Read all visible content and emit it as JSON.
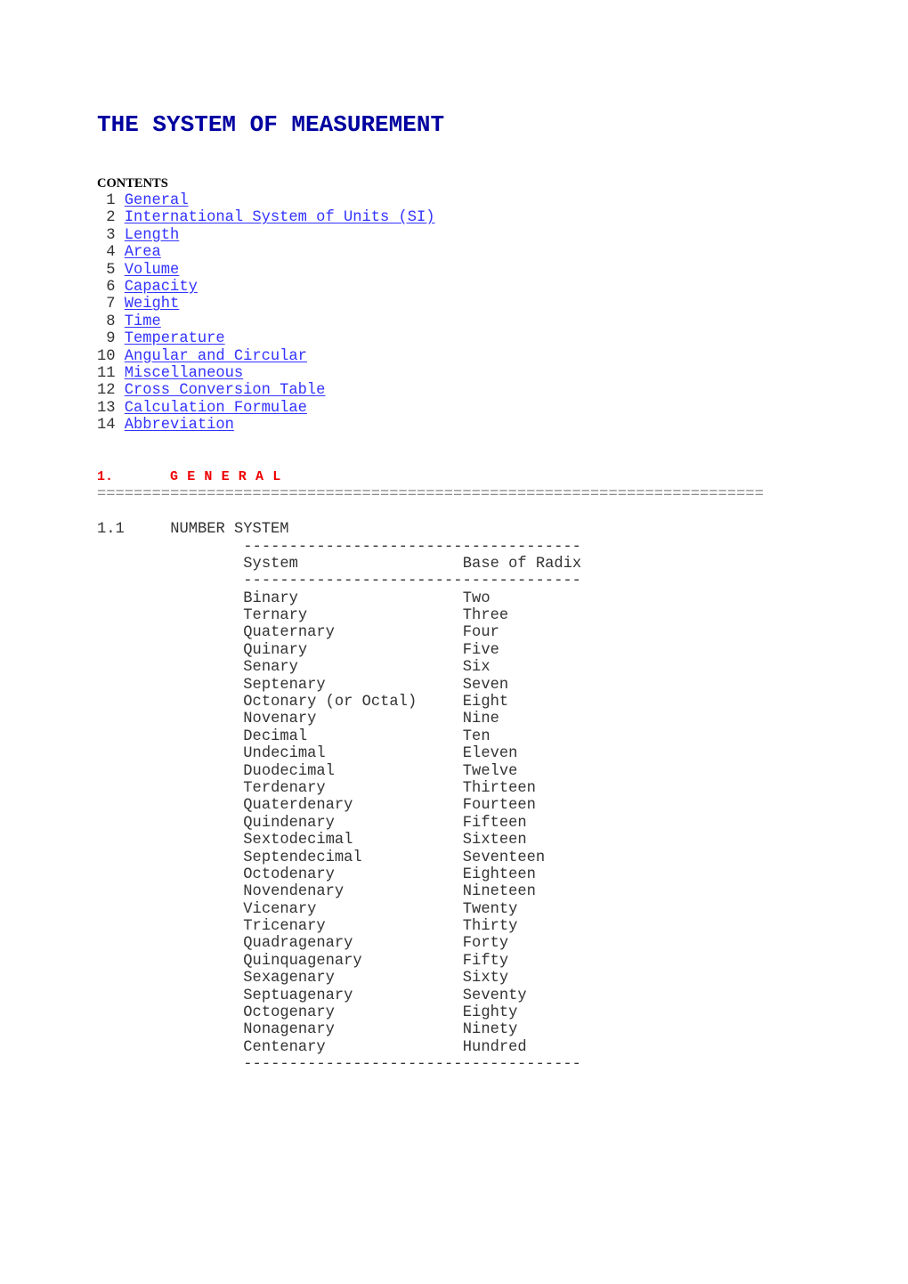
{
  "document": {
    "title": "THE SYSTEM OF MEASUREMENT",
    "contents": {
      "heading": "CONTENTS",
      "items": [
        {
          "num": "1",
          "label": "General"
        },
        {
          "num": "2",
          "label": "International System of Units (SI)"
        },
        {
          "num": "3",
          "label": "Length"
        },
        {
          "num": "4",
          "label": "Area"
        },
        {
          "num": "5",
          "label": "Volume"
        },
        {
          "num": "6",
          "label": "Capacity"
        },
        {
          "num": "7",
          "label": "Weight"
        },
        {
          "num": "8",
          "label": "Time"
        },
        {
          "num": "9",
          "label": "Temperature"
        },
        {
          "num": "10",
          "label": "Angular and Circular"
        },
        {
          "num": "11",
          "label": "Miscellaneous"
        },
        {
          "num": "12",
          "label": "Cross Conversion Table"
        },
        {
          "num": "13",
          "label": "Calculation Formulae"
        },
        {
          "num": "14",
          "label": "Abbreviation"
        }
      ]
    },
    "section": {
      "number": "1.",
      "title": "GENERAL",
      "rule": "========================================================================="
    },
    "subsection": {
      "number": "1.1",
      "title": "NUMBER SYSTEM",
      "table": {
        "rule": "-------------------------------------",
        "headers": {
          "system": "System",
          "base": "Base of Radix"
        },
        "rows": [
          {
            "system": "Binary",
            "base": "Two"
          },
          {
            "system": "Ternary",
            "base": "Three"
          },
          {
            "system": "Quaternary",
            "base": "Four"
          },
          {
            "system": "Quinary",
            "base": "Five"
          },
          {
            "system": "Senary",
            "base": "Six"
          },
          {
            "system": "Septenary",
            "base": "Seven"
          },
          {
            "system": "Octonary (or Octal)",
            "base": "Eight"
          },
          {
            "system": "Novenary",
            "base": "Nine"
          },
          {
            "system": "Decimal",
            "base": "Ten"
          },
          {
            "system": "Undecimal",
            "base": "Eleven"
          },
          {
            "system": "Duodecimal",
            "base": "Twelve"
          },
          {
            "system": "Terdenary",
            "base": "Thirteen"
          },
          {
            "system": "Quaterdenary",
            "base": "Fourteen"
          },
          {
            "system": "Quindenary",
            "base": "Fifteen"
          },
          {
            "system": "Sextodecimal",
            "base": "Sixteen"
          },
          {
            "system": "Septendecimal",
            "base": "Seventeen"
          },
          {
            "system": "Octodenary",
            "base": "Eighteen"
          },
          {
            "system": "Novendenary",
            "base": "Nineteen"
          },
          {
            "system": "Vicenary",
            "base": "Twenty"
          },
          {
            "system": "Tricenary",
            "base": "Thirty"
          },
          {
            "system": "Quadragenary",
            "base": "Forty"
          },
          {
            "system": "Quinquagenary",
            "base": "Fifty"
          },
          {
            "system": "Sexagenary",
            "base": "Sixty"
          },
          {
            "system": "Septuagenary",
            "base": "Seventy"
          },
          {
            "system": "Octogenary",
            "base": "Eighty"
          },
          {
            "system": "Nonagenary",
            "base": "Ninety"
          },
          {
            "system": "Centenary",
            "base": "Hundred"
          }
        ]
      }
    }
  },
  "colors": {
    "title": "#0000a0",
    "link": "#3333ff",
    "section_heading": "#ee0000",
    "body_text": "#333333"
  }
}
